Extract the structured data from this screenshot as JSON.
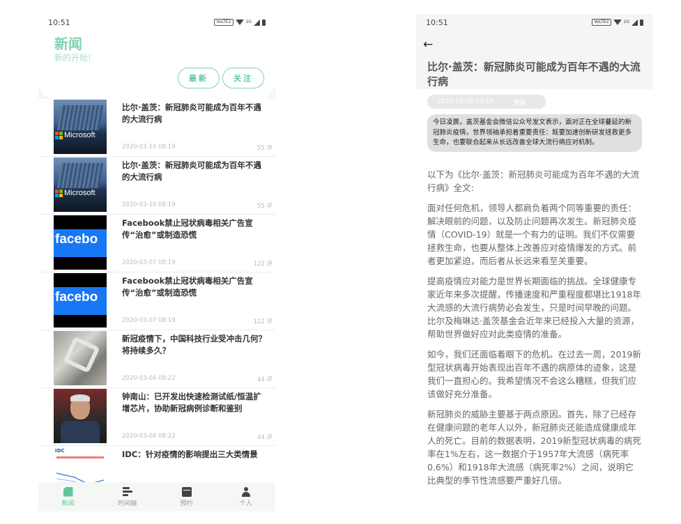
{
  "left": {
    "status": {
      "time": "10:51",
      "volte": "VoLTE2",
      "signal": "2G"
    },
    "header": {
      "title": "新闻",
      "subtitle": "新的开始!",
      "btn_latest": "最新",
      "btn_follow": "关注"
    },
    "items": [
      {
        "title": "比尔·盖茨：新冠肺炎可能成为百年不遇的大流行病",
        "date": "2020-03-10 08:19",
        "comments": "55 评",
        "thumb": "microsoft",
        "thumb_text": "Microsoft"
      },
      {
        "title": "比尔·盖茨：新冠肺炎可能成为百年不遇的大流行病",
        "date": "2020-03-10 08:19",
        "comments": "55 评",
        "thumb": "microsoft",
        "thumb_text": "Microsoft"
      },
      {
        "title": "Facebook禁止冠状病毒相关广告宣传“治愈”或制造恐慌",
        "date": "2020-03-07 08:19",
        "comments": "122 评",
        "thumb": "facebook",
        "thumb_text": "facebo"
      },
      {
        "title": "Facebook禁止冠状病毒相关广告宣传“治愈”或制造恐慌",
        "date": "2020-03-07 08:19",
        "comments": "122 评",
        "thumb": "facebook",
        "thumb_text": "facebo"
      },
      {
        "title": "新冠疫情下，中国科技行业受冲击几何？将持续多久？",
        "date": "2020-03-04 08:22",
        "comments": "44 评",
        "thumb": "lab"
      },
      {
        "title": "钟南山：已开发出快速检测试纸/恒温扩增芯片，协助新冠病例诊断和鉴别",
        "date": "2020-03-04 08:22",
        "comments": "44 评",
        "thumb": "man"
      },
      {
        "title": "IDC：针对疫情的影响提出三大类情景",
        "date": "",
        "comments": "",
        "thumb": "idc",
        "thumb_text": "IDC"
      }
    ],
    "nav": [
      {
        "label": "新闻",
        "icon": "news-icon",
        "active": true
      },
      {
        "label": "时间轴",
        "icon": "timeline-icon"
      },
      {
        "label": "预约",
        "icon": "calendar-icon"
      },
      {
        "label": "个人",
        "icon": "user-icon"
      }
    ],
    "accent": "#5fc79c"
  },
  "right": {
    "status": {
      "time": "10:51"
    },
    "title": "比尔·盖茨：新冠肺炎可能成为百年不遇的大流行病",
    "meta": {
      "date": "2020-03-10 08:19",
      "source": "懂猫"
    },
    "summary": "今日凌晨，盖茨基金会微信公众号发文表示，面对正在全球蔓延的新冠肺炎疫情，世界领袖承担着重要责任：既要加速创新研发拯救更多生命，也要联合起来从长远改善全球大流行病应对机制。",
    "paragraphs": [
      "以下为《比尔·盖茨：新冠肺炎可能成为百年不遇的大流行病》全文:",
      "面对任何危机，领导人都肩负着两个同等重要的责任：解决眼前的问题，以及防止问题再次发生。新冠肺炎疫情（COVID-19）就是一个有力的证明。我们不仅需要拯救生命，也要从整体上改善应对疫情爆发的方式。前者更加紧迫，而后者从长远来看至关重要。",
      "提高疫情应对能力是世界长期面临的挑战。全球健康专家近年来多次提醒，传播速度和严重程度都堪比1918年大流感的大流行病势必会发生，只是时间早晚的问题。比尔及梅琳达·盖茨基金会近年来已经投入大量的资源，帮助世界做好应对此类疫情的准备。",
      "如今，我们还面临着眼下的危机。在过去一周，2019新型冠状病毒开始表现出百年不遇的病原体的迹象，这是我们一直担心的。我希望情况不会这么糟糕，但我们应该做好充分准备。",
      "新冠肺炎的威胁主要基于两点原因。首先，除了已经存在健康问题的老年人以外，新冠肺炎还能造成健康成年人的死亡。目前的数据表明，2019新型冠状病毒的病死率在1%左右，这一数据介于1957年大流感（病死率0.6%）和1918年大流感（病死率2%）之间，说明它比典型的季节性流感要严重好几倍。"
    ]
  }
}
